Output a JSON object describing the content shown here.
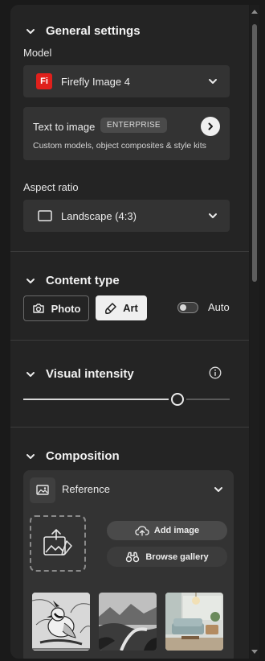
{
  "general": {
    "title": "General settings",
    "model_label": "Model",
    "model_logo": "Fi",
    "model_value": "Firefly Image 4",
    "t2i_title": "Text to image",
    "t2i_badge": "ENTERPRISE",
    "t2i_desc": "Custom models, object composites & style kits",
    "aspect_label": "Aspect ratio",
    "aspect_value": "Landscape (4:3)"
  },
  "content_type": {
    "title": "Content type",
    "photo": "Photo",
    "art": "Art",
    "selected": "Art",
    "auto": "Auto",
    "auto_on": false
  },
  "visual_intensity": {
    "title": "Visual intensity",
    "value": 0.75
  },
  "composition": {
    "title": "Composition",
    "reference_label": "Reference",
    "add_image": "Add image",
    "browse_gallery": "Browse gallery"
  },
  "icons": [
    "chevron-down-icon",
    "camera-icon",
    "brush-icon",
    "info-icon",
    "reference-image-icon",
    "upload-image-icon",
    "cloud-upload-icon",
    "binoculars-icon",
    "chevron-right-icon"
  ],
  "colors": {
    "accent_red": "#e0201c",
    "panel": "#242424",
    "field": "#333333"
  }
}
